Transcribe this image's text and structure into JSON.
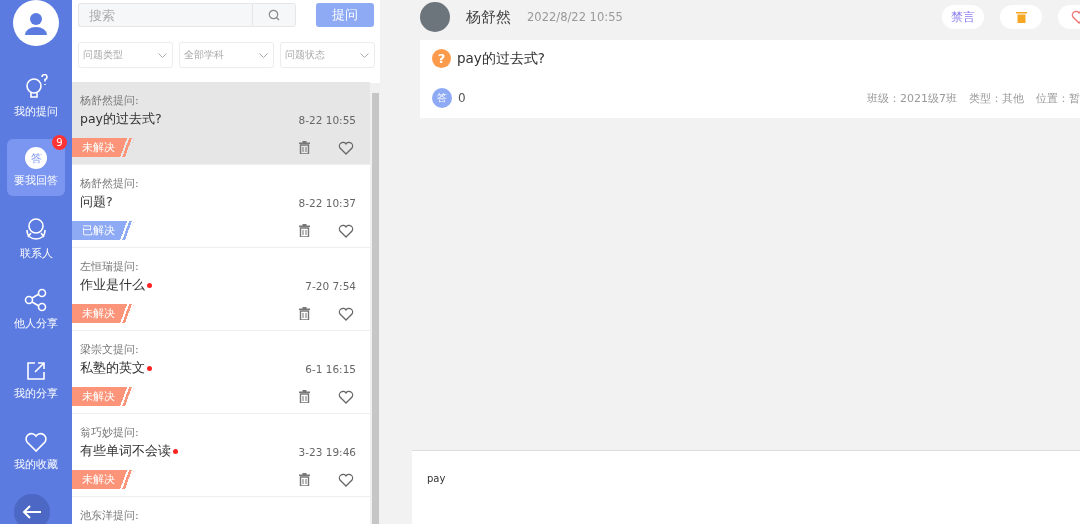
{
  "sidebar": {
    "items": [
      {
        "label": "我的提问",
        "selected": false
      },
      {
        "label": "要我回答",
        "selected": true,
        "badge": "9",
        "mark": "答"
      },
      {
        "label": "联系人",
        "selected": false
      },
      {
        "label": "他人分享",
        "selected": false
      },
      {
        "label": "我的分享",
        "selected": false
      },
      {
        "label": "我的收藏",
        "selected": false
      }
    ]
  },
  "search": {
    "placeholder": "搜索",
    "button": "提问"
  },
  "filters": [
    {
      "placeholder": "问题类型"
    },
    {
      "placeholder": "全部学科"
    },
    {
      "placeholder": "问题状态"
    }
  ],
  "questions": [
    {
      "asker": "杨舒然提问:",
      "title": "pay的过去式?",
      "unread": false,
      "time": "8-22 10:55",
      "status": "未解决",
      "kind": "unsolved",
      "selected": true
    },
    {
      "asker": "杨舒然提问:",
      "title": "问题?",
      "unread": false,
      "time": "8-22 10:37",
      "status": "已解决",
      "kind": "solved",
      "selected": false
    },
    {
      "asker": "左恒瑞提问:",
      "title": "作业是什么",
      "unread": true,
      "time": "7-20 7:54",
      "status": "未解决",
      "kind": "unsolved",
      "selected": false
    },
    {
      "asker": "梁崇文提问:",
      "title": "私塾的英文",
      "unread": true,
      "time": "6-1 16:15",
      "status": "未解决",
      "kind": "unsolved",
      "selected": false
    },
    {
      "asker": "翁巧妙提问:",
      "title": "有些单词不会读",
      "unread": true,
      "time": "3-23 19:46",
      "status": "未解决",
      "kind": "unsolved",
      "selected": false
    },
    {
      "asker": "池东洋提问:",
      "selected": false
    }
  ],
  "detail": {
    "name": "杨舒然",
    "date": "2022/8/22 10:55",
    "mute_button": "禁言",
    "question_mark": "?",
    "question": "pay的过去式?",
    "answer_mark": "答",
    "answer_count": "0",
    "meta": [
      "班级：2021级7班",
      "类型：其他",
      "位置：暂"
    ]
  },
  "reply": {
    "value": "pay"
  }
}
